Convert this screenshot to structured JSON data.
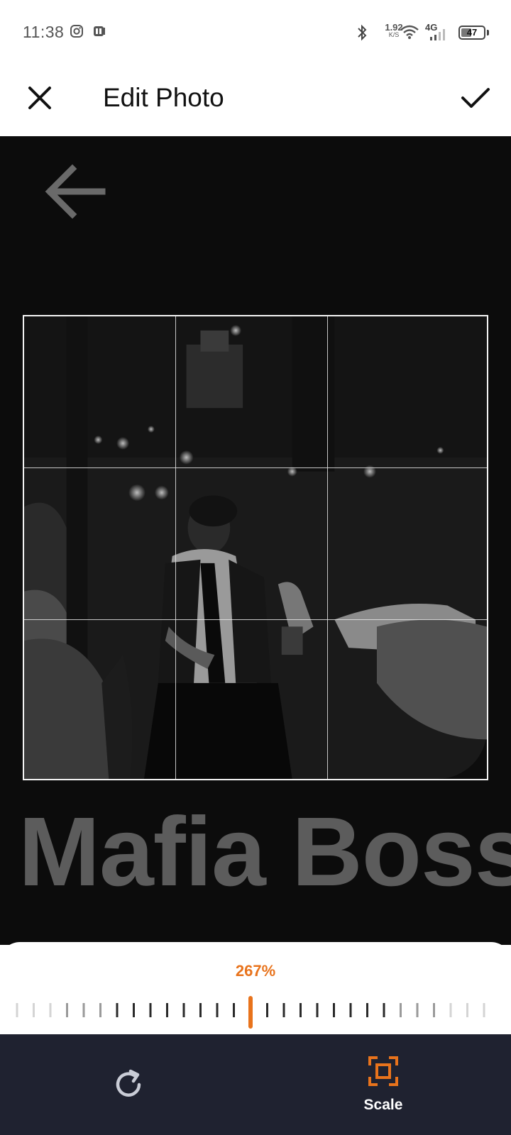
{
  "status_bar": {
    "time": "11:38",
    "network_speed_value": "1.92",
    "network_speed_unit": "K/S",
    "cellular_label": "4G",
    "battery_level": "47",
    "icons": [
      "instagram-icon",
      "app-notification-icon",
      "bluetooth-icon",
      "wifi-icon",
      "signal-icon",
      "battery-icon"
    ]
  },
  "header": {
    "title": "Edit Photo",
    "close_icon": "close-icon",
    "confirm_icon": "check-icon"
  },
  "canvas": {
    "background_text": "Mafia Boss",
    "background_icon": "back-arrow-icon"
  },
  "scale": {
    "value_label": "267%",
    "accent_color": "#e8731c"
  },
  "toolbar": {
    "rotate_icon": "rotate-icon",
    "scale_label": "Scale",
    "scale_icon": "scale-frame-icon"
  },
  "colors": {
    "accent": "#e8731c",
    "toolbar_bg": "#1f2230",
    "editor_bg": "#0c0c0c"
  }
}
